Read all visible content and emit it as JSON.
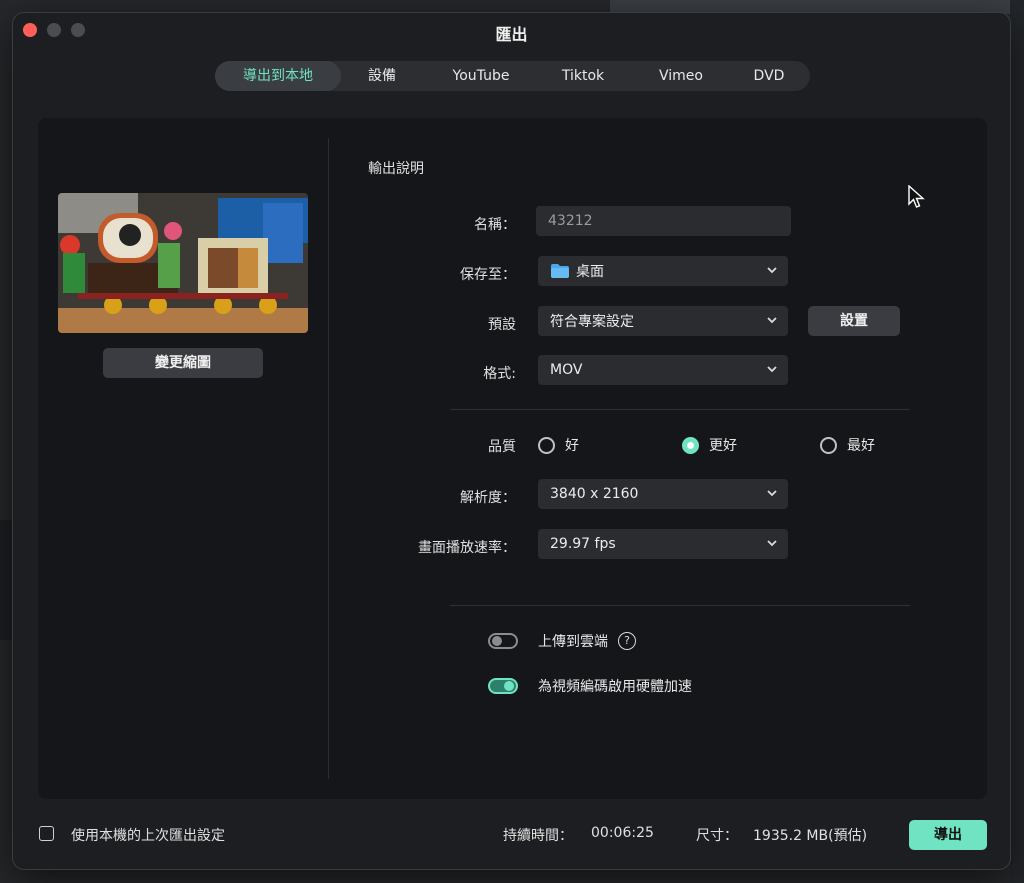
{
  "window": {
    "title": "匯出"
  },
  "tabs": [
    {
      "label": "導出到本地",
      "active": true
    },
    {
      "label": "設備"
    },
    {
      "label": "YouTube"
    },
    {
      "label": "Tiktok"
    },
    {
      "label": "Vimeo"
    },
    {
      "label": "DVD"
    }
  ],
  "thumbnail": {
    "change_label": "變更縮圖"
  },
  "section": {
    "title": "輸出說明"
  },
  "fields": {
    "name": {
      "label": "名稱：",
      "value": "43212"
    },
    "save_to": {
      "label": "保存至：",
      "value": "桌面"
    },
    "preset": {
      "label": "預設",
      "value": "符合專案設定",
      "button": "設置"
    },
    "format": {
      "label": "格式:",
      "value": "MOV"
    },
    "quality": {
      "label": "品質",
      "options": [
        "好",
        "更好",
        "最好"
      ],
      "selected": "更好"
    },
    "resolution": {
      "label": "解析度：",
      "value": "3840 x 2160"
    },
    "frame_rate": {
      "label": "畫面播放速率：",
      "value": "29.97 fps"
    }
  },
  "toggles": {
    "upload_cloud": {
      "label": "上傳到雲端",
      "on": false,
      "help": "?"
    },
    "hw_accel": {
      "label": "為視頻編碼啟用硬體加速",
      "on": true
    }
  },
  "footer": {
    "use_last_label": "使用本機的上次匯出設定",
    "duration_label": "持續時間：",
    "duration_value": "00:06:25",
    "size_label": "尺寸：",
    "size_value": "1935.2 MB(預估)",
    "export_label": "導出"
  },
  "colors": {
    "accent": "#6fe3c2",
    "close": "#ff5f57"
  }
}
